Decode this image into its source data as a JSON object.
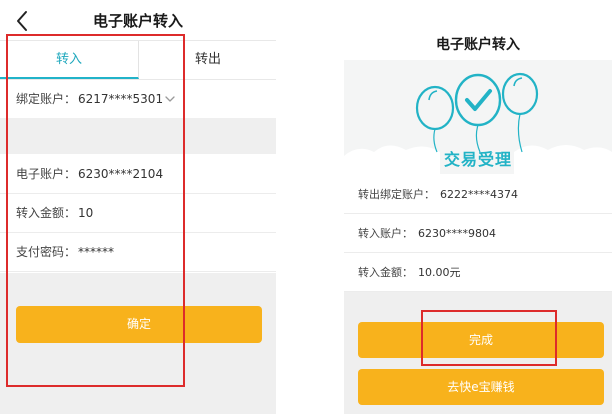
{
  "colors": {
    "accent_teal": "#21b3c9",
    "button_orange": "#f8b21c",
    "highlight_red": "#dd2b2b",
    "background_gray": "#efefef"
  },
  "left_screen": {
    "title": "电子账户转入",
    "back_icon": "chevron-left-icon",
    "tabs": {
      "transfer_in": "转入",
      "transfer_out": "转出"
    },
    "bound_account": {
      "label": "绑定账户：",
      "value": "6217****5301",
      "icon": "chevron-down-icon"
    },
    "electronic_account": {
      "label": "电子账户：",
      "value": "6230****2104"
    },
    "amount": {
      "label": "转入金额：",
      "value": "10"
    },
    "password": {
      "label": "支付密码：",
      "value": "******"
    },
    "confirm_button": "确定"
  },
  "right_screen": {
    "title": "电子账户转入",
    "banner_text": "交易受理",
    "banner_icons": [
      "balloon-icon",
      "checkmark-balloon-icon",
      "balloon-icon"
    ],
    "rows": [
      {
        "label": "转出绑定账户：",
        "value": "6222****4374"
      },
      {
        "label": "转入账户：",
        "value": "6230****9804"
      },
      {
        "label": "转入金额：",
        "value": "10.00元"
      }
    ],
    "done_button": "完成",
    "earn_button": "去快e宝赚钱"
  }
}
